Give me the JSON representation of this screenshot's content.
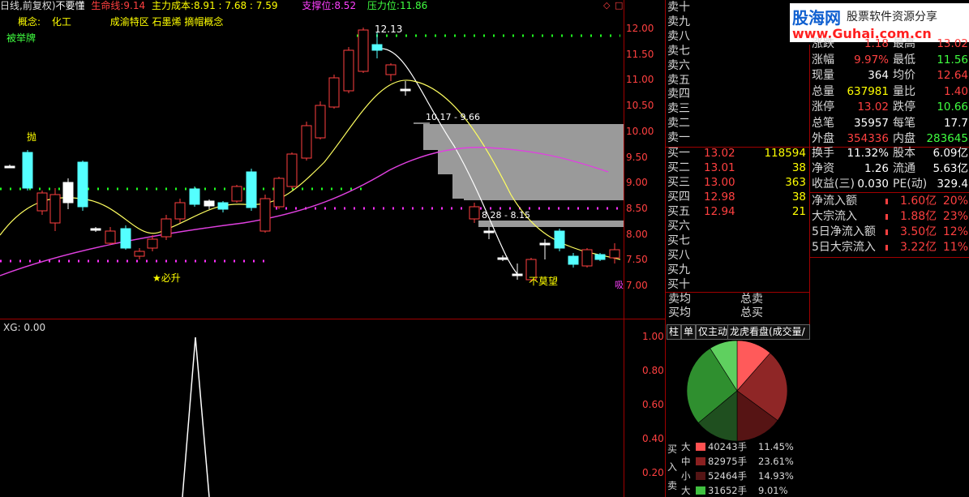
{
  "header": {
    "period": "日线,前复权)",
    "stock_name": "不要懂",
    "lifeline_label": "生命线:",
    "lifeline_value": "9.14",
    "main_cost_label": "主力成本:",
    "main_cost_value": "8.91 : 7.68 : 7.59",
    "support_label": "支撑位:",
    "support_value": "8.52",
    "pressure_label": "压力位:",
    "pressure_value": "11.86",
    "concept_label": "概念:",
    "concept_industry": "化工",
    "concept_tags": "成渝特区 石墨烯 摘帽概念",
    "tag_line": "被举牌"
  },
  "watermark": {
    "brand": "股海网",
    "slogan": "股票软件资源分享",
    "url": "www.Guhai.com.cn"
  },
  "chart_annotations": {
    "peak_label": "12.13",
    "range_label_1": "10.17 - 9.66",
    "range_label_2": "8.28 - 8.15",
    "signal_sell": "抛",
    "signal_must_rise": "★必升",
    "signal_dont_look": "不莫望",
    "signal_buy_edge": "吸"
  },
  "price_axis": [
    "12.00",
    "11.50",
    "11.00",
    "10.50",
    "10.00",
    "9.50",
    "9.00",
    "8.50",
    "8.00",
    "7.50",
    "7.00"
  ],
  "indicator": {
    "label": "XG: 0.00",
    "axis": [
      "1.00",
      "0.80",
      "0.60",
      "0.40",
      "0.20"
    ]
  },
  "order_book": {
    "sell_labels": [
      "卖十",
      "卖九",
      "卖八",
      "卖七",
      "卖六",
      "卖五",
      "卖四",
      "卖三",
      "卖二",
      "卖一"
    ],
    "buy": [
      {
        "label": "买一",
        "price": "13.02",
        "volume": "118594"
      },
      {
        "label": "买二",
        "price": "13.01",
        "volume": "38"
      },
      {
        "label": "买三",
        "price": "13.00",
        "volume": "363"
      },
      {
        "label": "买四",
        "price": "12.98",
        "volume": "38"
      },
      {
        "label": "买五",
        "price": "12.94",
        "volume": "21"
      }
    ],
    "buy_empty_labels": [
      "买六",
      "买七",
      "买八",
      "买九",
      "买十"
    ],
    "avg_sell_label": "卖均",
    "total_sell_label": "总卖",
    "avg_buy_label": "买均",
    "total_buy_label": "总买"
  },
  "stats": {
    "rows": [
      {
        "l1": "涨跌",
        "v1": "1.18",
        "c1": "red",
        "l2": "最高",
        "v2": "13.02",
        "c2": "red"
      },
      {
        "l1": "涨幅",
        "v1": "9.97%",
        "c1": "red",
        "l2": "最低",
        "v2": "11.56",
        "c2": "green"
      },
      {
        "l1": "现量",
        "v1": "364",
        "c1": "white",
        "l2": "均价",
        "v2": "12.64",
        "c2": "red"
      },
      {
        "l1": "总量",
        "v1": "637981",
        "c1": "yellow",
        "l2": "量比",
        "v2": "1.40",
        "c2": "red"
      },
      {
        "l1": "涨停",
        "v1": "13.02",
        "c1": "red",
        "l2": "跌停",
        "v2": "10.66",
        "c2": "green"
      },
      {
        "l1": "总笔",
        "v1": "35957",
        "c1": "white",
        "l2": "每笔",
        "v2": "17.7",
        "c2": "white"
      },
      {
        "l1": "外盘",
        "v1": "354336",
        "c1": "red",
        "l2": "内盘",
        "v2": "283645",
        "c2": "green"
      },
      {
        "l1": "换手",
        "v1": "11.32%",
        "c1": "white",
        "l2": "股本",
        "v2": "6.09亿",
        "c2": "white"
      },
      {
        "l1": "净资",
        "v1": "1.26",
        "c1": "white",
        "l2": "流通",
        "v2": "5.63亿",
        "c2": "white"
      },
      {
        "l1": "收益(三)",
        "v1": "0.030",
        "c1": "white",
        "l2": "PE(动)",
        "v2": "329.4",
        "c2": "white"
      }
    ]
  },
  "capital_flow": [
    {
      "label": "净流入额",
      "value": "1.60亿",
      "pct": "20%"
    },
    {
      "label": "大宗流入",
      "value": "1.88亿",
      "pct": "23%"
    },
    {
      "label": "5日净流入额",
      "value": "3.50亿",
      "pct": "12%"
    },
    {
      "label": "5日大宗流入",
      "value": "3.22亿",
      "pct": "11%"
    }
  ],
  "tabs": [
    "柱",
    "单",
    "仅主动",
    "龙虎看盘(成交量/按"
  ],
  "volume_breakdown": {
    "buy_side": "买入",
    "sell_side": "卖",
    "rows": [
      {
        "size": "大",
        "volume": "40243手",
        "pct": "11.45%",
        "color": "#ff5050"
      },
      {
        "size": "中",
        "volume": "82975手",
        "pct": "23.61%",
        "color": "#8b2020"
      },
      {
        "size": "小",
        "volume": "52464手",
        "pct": "14.93%",
        "color": "#551515"
      },
      {
        "size": "大",
        "volume": "31652手",
        "pct": "9.01%",
        "color": "#40c040"
      }
    ]
  },
  "pie": {
    "slices": [
      {
        "name": "buy-large",
        "pct": 11.45,
        "color": "#ff5a5a"
      },
      {
        "name": "buy-medium",
        "pct": 23.61,
        "color": "#8f2626"
      },
      {
        "name": "buy-small",
        "pct": 14.93,
        "color": "#561414"
      },
      {
        "name": "sell-small",
        "pct": 14.0,
        "color": "#1f4f1f"
      },
      {
        "name": "sell-medium",
        "pct": 27.0,
        "color": "#2f8f2f"
      },
      {
        "name": "sell-large",
        "pct": 9.01,
        "color": "#5fd05f"
      }
    ]
  }
}
